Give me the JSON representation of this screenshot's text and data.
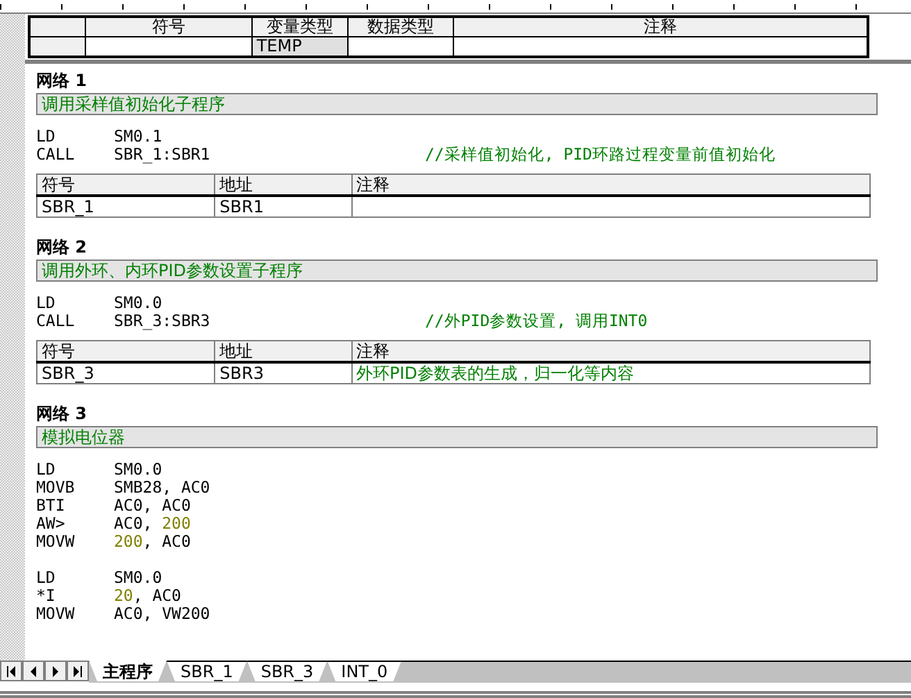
{
  "var_table": {
    "columns": [
      "符号",
      "变量类型",
      "数据类型",
      "注释"
    ],
    "rows": [
      [
        "",
        "TEMP",
        "",
        ""
      ]
    ]
  },
  "networks": [
    {
      "title": "网络 1",
      "comment": "调用采样值初始化子程序",
      "groups": [
        [
          {
            "op": "LD",
            "args": [
              {
                "text": "SM0.1",
                "kind": "plain"
              }
            ]
          },
          {
            "op": "CALL",
            "args": [
              {
                "text": "SBR_1:SBR1",
                "kind": "plain"
              }
            ],
            "comment": "//采样值初始化, PID环路过程变量前值初始化"
          }
        ]
      ],
      "symbols": {
        "columns": [
          "符号",
          "地址",
          "注释"
        ],
        "rows": [
          [
            "SBR_1",
            "SBR1",
            ""
          ]
        ]
      }
    },
    {
      "title": "网络 2",
      "comment": "调用外环、内环PID参数设置子程序",
      "groups": [
        [
          {
            "op": "LD",
            "args": [
              {
                "text": "SM0.0",
                "kind": "plain"
              }
            ]
          },
          {
            "op": "CALL",
            "args": [
              {
                "text": "SBR_3:SBR3",
                "kind": "plain"
              }
            ],
            "comment": "//外PID参数设置, 调用INT0"
          }
        ]
      ],
      "symbols": {
        "columns": [
          "符号",
          "地址",
          "注释"
        ],
        "rows": [
          [
            "SBR_3",
            "SBR3",
            "外环PID参数表的生成，归一化等内容"
          ]
        ]
      }
    },
    {
      "title": "网络 3",
      "comment": "模拟电位器",
      "groups": [
        [
          {
            "op": "LD",
            "args": [
              {
                "text": "SM0.0",
                "kind": "plain"
              }
            ]
          },
          {
            "op": "MOVB",
            "args": [
              {
                "text": "SMB28, AC0",
                "kind": "plain"
              }
            ]
          },
          {
            "op": "BTI",
            "args": [
              {
                "text": "AC0, AC0",
                "kind": "plain"
              }
            ]
          },
          {
            "op": "AW>",
            "args": [
              {
                "text": "AC0, ",
                "kind": "plain"
              },
              {
                "text": "200",
                "kind": "constant"
              }
            ]
          },
          {
            "op": "MOVW",
            "args": [
              {
                "text": "200",
                "kind": "constant"
              },
              {
                "text": ", AC0",
                "kind": "plain"
              }
            ]
          }
        ],
        [
          {
            "op": "LD",
            "args": [
              {
                "text": "SM0.0",
                "kind": "plain"
              }
            ]
          },
          {
            "op": "*I",
            "args": [
              {
                "text": "20",
                "kind": "constant"
              },
              {
                "text": ", AC0",
                "kind": "plain"
              }
            ]
          },
          {
            "op": "MOVW",
            "args": [
              {
                "text": "AC0, VW200",
                "kind": "plain"
              }
            ]
          }
        ]
      ]
    }
  ],
  "tabs": [
    {
      "label": "主程序",
      "selected": true
    },
    {
      "label": "SBR_1",
      "selected": false
    },
    {
      "label": "SBR_3",
      "selected": false
    },
    {
      "label": "INT_0",
      "selected": false
    }
  ]
}
